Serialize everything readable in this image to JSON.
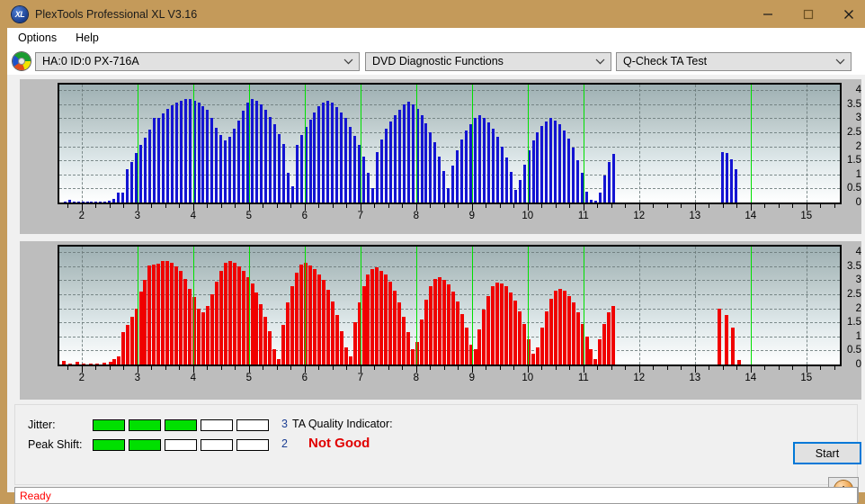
{
  "window": {
    "title": "PlexTools Professional XL V3.16",
    "app_badge": "XL",
    "minimize_label": "Minimize",
    "maximize_label": "Maximize",
    "close_label": "Close"
  },
  "menu": {
    "items": [
      "Options",
      "Help"
    ]
  },
  "toolbar": {
    "drive": {
      "value": "HA:0 ID:0  PX-716A",
      "icon": "disc-icon"
    },
    "function": {
      "value": "DVD Diagnostic Functions"
    },
    "test": {
      "value": "Q-Check TA Test"
    }
  },
  "results": {
    "jitter_label": "Jitter:",
    "jitter_value": "3",
    "jitter_filled": 3,
    "jitter_cells": 5,
    "peak_shift_label": "Peak Shift:",
    "peak_shift_value": "2",
    "peak_shift_filled": 2,
    "peak_shift_cells": 5,
    "ta_label": "TA Quality Indicator:",
    "ta_value": "Not Good",
    "ta_value_color": "#e00000"
  },
  "buttons": {
    "start": "Start",
    "info": "i"
  },
  "statusbar": {
    "text": "Ready"
  },
  "colors": {
    "titlebar": "#c49a5a",
    "jitter_bar": "#1414d2",
    "peak_bar": "#f00000",
    "marker": "#00e000",
    "meter_on": "#00e000",
    "status_text": "#ff0000"
  },
  "chart_data": [
    {
      "type": "bar",
      "id": "jitter-chart",
      "title": "",
      "xlabel": "",
      "ylabel": "",
      "bar_color": "#1414d2",
      "grid": true,
      "xlim": [
        1.6,
        15.6
      ],
      "ylim": [
        0,
        4.2
      ],
      "yticks": [
        0,
        0.5,
        1,
        1.5,
        2,
        2.5,
        3,
        3.5,
        4
      ],
      "ytick_labels": [
        "0",
        "0.5",
        "1",
        "1.5",
        "2",
        "2.5",
        "3",
        "3.5",
        "4"
      ],
      "xticks": [
        2,
        3,
        4,
        5,
        6,
        7,
        8,
        9,
        10,
        11,
        12,
        13,
        14,
        15
      ],
      "xtick_labels": [
        "2",
        "3",
        "4",
        "5",
        "6",
        "7",
        "8",
        "9",
        "10",
        "11",
        "12",
        "13",
        "14",
        "15"
      ],
      "markers": [
        3,
        4,
        5,
        6,
        7,
        8,
        9,
        10,
        11,
        14
      ],
      "x": [
        1.7,
        1.78,
        1.86,
        1.94,
        2.02,
        2.1,
        2.18,
        2.26,
        2.34,
        2.42,
        2.5,
        2.58,
        2.66,
        2.74,
        2.82,
        2.9,
        2.98,
        3.06,
        3.14,
        3.22,
        3.3,
        3.38,
        3.46,
        3.54,
        3.62,
        3.7,
        3.78,
        3.86,
        3.94,
        4.02,
        4.1,
        4.18,
        4.26,
        4.34,
        4.42,
        4.5,
        4.58,
        4.66,
        4.74,
        4.82,
        4.9,
        4.98,
        5.06,
        5.14,
        5.22,
        5.3,
        5.38,
        5.46,
        5.54,
        5.62,
        5.7,
        5.78,
        5.86,
        5.94,
        6.02,
        6.1,
        6.18,
        6.26,
        6.34,
        6.42,
        6.5,
        6.58,
        6.66,
        6.74,
        6.82,
        6.9,
        6.98,
        7.06,
        7.14,
        7.22,
        7.3,
        7.38,
        7.46,
        7.54,
        7.62,
        7.7,
        7.78,
        7.86,
        7.94,
        8.02,
        8.1,
        8.18,
        8.26,
        8.34,
        8.42,
        8.5,
        8.58,
        8.66,
        8.74,
        8.82,
        8.9,
        8.98,
        9.06,
        9.14,
        9.22,
        9.3,
        9.38,
        9.46,
        9.54,
        9.62,
        9.7,
        9.78,
        9.86,
        9.94,
        10.02,
        10.1,
        10.18,
        10.26,
        10.34,
        10.42,
        10.5,
        10.58,
        10.66,
        10.74,
        10.82,
        10.9,
        10.98,
        11.06,
        11.14,
        11.22,
        11.3,
        11.38,
        11.46,
        11.54,
        13.5,
        13.58,
        13.66,
        13.74,
        13.82,
        13.9,
        13.98,
        14.06
      ],
      "values": [
        0.0,
        0.1,
        0.0,
        0.0,
        0.0,
        0.0,
        0.0,
        0.0,
        0.0,
        0.0,
        0.08,
        0.12,
        0.35,
        0.34,
        1.2,
        1.45,
        1.75,
        2.05,
        2.3,
        2.6,
        3.0,
        3.0,
        3.18,
        3.33,
        3.45,
        3.55,
        3.62,
        3.7,
        3.69,
        3.62,
        3.55,
        3.43,
        3.3,
        3.02,
        2.65,
        2.42,
        2.2,
        2.35,
        2.62,
        2.92,
        3.28,
        3.57,
        3.7,
        3.62,
        3.48,
        3.3,
        3.05,
        2.78,
        2.45,
        2.1,
        1.05,
        0.58,
        2.05,
        2.42,
        2.7,
        2.95,
        3.2,
        3.42,
        3.55,
        3.62,
        3.55,
        3.4,
        3.22,
        3.0,
        2.7,
        2.36,
        2.05,
        1.62,
        1.05,
        0.5,
        1.8,
        2.25,
        2.62,
        2.9,
        3.1,
        3.3,
        3.48,
        3.6,
        3.48,
        3.35,
        3.12,
        2.82,
        2.5,
        2.15,
        1.62,
        1.12,
        0.52,
        1.3,
        1.85,
        2.25,
        2.55,
        2.8,
        3.0,
        3.1,
        3.02,
        2.85,
        2.62,
        2.35,
        2.0,
        1.6,
        1.1,
        0.45,
        0.8,
        1.35,
        1.85,
        2.2,
        2.5,
        2.72,
        2.88,
        3.0,
        2.92,
        2.78,
        2.55,
        2.28,
        1.95,
        1.5,
        1.05,
        0.4,
        0.1,
        0.05,
        0.35,
        0.95,
        1.45,
        1.72,
        1.8,
        1.75,
        1.55,
        1.2
      ]
    },
    {
      "type": "bar",
      "id": "peak-shift-chart",
      "title": "",
      "xlabel": "",
      "ylabel": "",
      "bar_color": "#f00000",
      "grid": true,
      "xlim": [
        1.6,
        15.6
      ],
      "ylim": [
        0,
        4.2
      ],
      "yticks": [
        0,
        0.5,
        1,
        1.5,
        2,
        2.5,
        3,
        3.5,
        4
      ],
      "ytick_labels": [
        "0",
        "0.5",
        "1",
        "1.5",
        "2",
        "2.5",
        "3",
        "3.5",
        "4"
      ],
      "xticks": [
        2,
        3,
        4,
        5,
        6,
        7,
        8,
        9,
        10,
        11,
        12,
        13,
        14,
        15
      ],
      "xtick_labels": [
        "2",
        "3",
        "4",
        "5",
        "6",
        "7",
        "8",
        "9",
        "10",
        "11",
        "12",
        "13",
        "14",
        "15"
      ],
      "markers": [
        3,
        4,
        5,
        6,
        7,
        8,
        9,
        10,
        11,
        14
      ],
      "x": [
        1.68,
        1.8,
        1.92,
        2.04,
        2.16,
        2.28,
        2.4,
        2.52,
        2.58,
        2.66,
        2.74,
        2.82,
        2.9,
        2.98,
        3.06,
        3.14,
        3.22,
        3.3,
        3.38,
        3.46,
        3.54,
        3.62,
        3.7,
        3.78,
        3.86,
        3.94,
        4.02,
        4.1,
        4.18,
        4.26,
        4.34,
        4.42,
        4.5,
        4.58,
        4.66,
        4.74,
        4.82,
        4.9,
        4.98,
        5.06,
        5.14,
        5.22,
        5.3,
        5.38,
        5.46,
        5.54,
        5.62,
        5.7,
        5.78,
        5.86,
        5.94,
        6.02,
        6.1,
        6.18,
        6.26,
        6.34,
        6.42,
        6.5,
        6.58,
        6.66,
        6.74,
        6.82,
        6.9,
        6.98,
        7.06,
        7.14,
        7.22,
        7.3,
        7.38,
        7.46,
        7.54,
        7.62,
        7.7,
        7.78,
        7.86,
        7.94,
        8.02,
        8.1,
        8.18,
        8.26,
        8.34,
        8.42,
        8.5,
        8.58,
        8.66,
        8.74,
        8.82,
        8.9,
        8.98,
        9.06,
        9.14,
        9.22,
        9.3,
        9.38,
        9.46,
        9.54,
        9.62,
        9.7,
        9.78,
        9.86,
        9.94,
        10.02,
        10.1,
        10.18,
        10.26,
        10.34,
        10.42,
        10.5,
        10.58,
        10.66,
        10.74,
        10.82,
        10.9,
        10.98,
        11.06,
        11.14,
        11.22,
        11.3,
        11.38,
        11.46,
        11.54,
        13.44,
        13.56,
        13.68,
        13.8,
        13.92,
        14.04,
        14.16,
        14.4
      ],
      "values": [
        0.12,
        0.0,
        0.1,
        0.0,
        0.0,
        0.0,
        0.08,
        0.1,
        0.18,
        0.3,
        1.15,
        1.4,
        1.7,
        2.0,
        2.6,
        3.0,
        3.52,
        3.55,
        3.6,
        3.7,
        3.68,
        3.62,
        3.5,
        3.32,
        3.05,
        2.7,
        2.42,
        2.0,
        1.85,
        2.1,
        2.5,
        2.95,
        3.35,
        3.62,
        3.7,
        3.62,
        3.5,
        3.35,
        3.1,
        2.9,
        2.55,
        2.15,
        1.7,
        1.2,
        0.55,
        0.2,
        1.4,
        2.2,
        2.8,
        3.28,
        3.55,
        3.62,
        3.52,
        3.4,
        3.22,
        3.0,
        2.65,
        2.25,
        1.75,
        1.2,
        0.6,
        0.3,
        1.5,
        2.2,
        2.8,
        3.2,
        3.4,
        3.45,
        3.35,
        3.2,
        2.95,
        2.62,
        2.22,
        1.7,
        1.15,
        0.55,
        0.8,
        1.6,
        2.3,
        2.78,
        3.05,
        3.12,
        3.02,
        2.85,
        2.6,
        2.25,
        1.8,
        1.3,
        0.7,
        0.55,
        1.25,
        1.95,
        2.45,
        2.78,
        2.92,
        2.9,
        2.78,
        2.58,
        2.28,
        1.9,
        1.45,
        0.9,
        0.4,
        0.6,
        1.3,
        1.9,
        2.35,
        2.62,
        2.7,
        2.62,
        2.45,
        2.2,
        1.85,
        1.45,
        1.0,
        0.55,
        0.2,
        0.9,
        1.45,
        1.85,
        2.1,
        2.0,
        1.75,
        1.3,
        0.15
      ]
    }
  ]
}
